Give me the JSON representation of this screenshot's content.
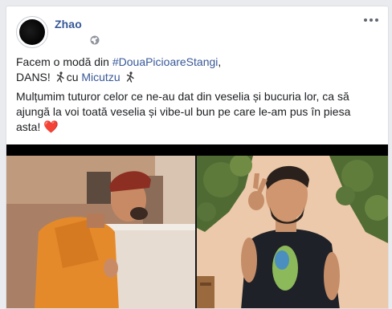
{
  "post": {
    "author": "Zhao",
    "privacy_icon": "globe-icon",
    "more_icon": "more-options-icon",
    "line1_prefix": "Facem o modă din ",
    "hashtag": "#DouaPicioareStangi",
    "line1_suffix": ",",
    "line2_prefix": "DANS! ",
    "with_word": "cu ",
    "tagged": "Micutzu",
    "paragraph_lines": [
      "Mulțumim tuturor celor ce ne-au dat din veselia și bucuria lor, ca să",
      "ajungă la voi toată veselia și vibe-ul bun pe care le-am pus în piesa"
    ],
    "last_line": "asta! ",
    "heart": "❤️"
  },
  "colors": {
    "link": "#385898",
    "text": "#1c1e21",
    "heart": "#e0245e",
    "shirt_left": "#e6892c",
    "shirt_right": "#1f2128"
  }
}
